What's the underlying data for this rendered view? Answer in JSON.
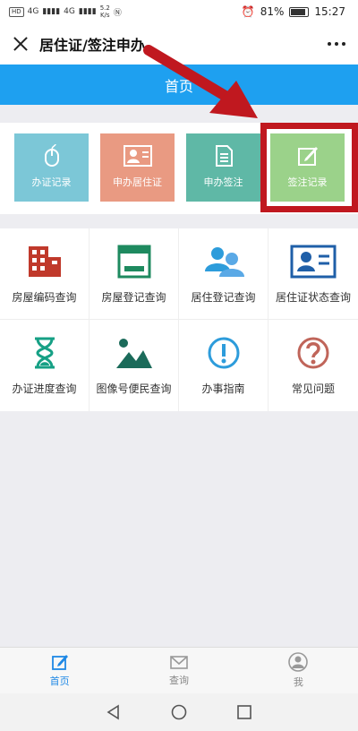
{
  "status_bar": {
    "network_left": "HD",
    "network_4g_1": "4G",
    "network_4g_2": "4G",
    "speed": "5.2",
    "speed_unit": "K/s",
    "battery_percent": "81%",
    "time": "15:27"
  },
  "header": {
    "title": "居住证/签注申办"
  },
  "blue_bar": {
    "title": "首页"
  },
  "quick_actions": [
    {
      "label": "办证记录",
      "color": "#7cc7d7",
      "icon": "mouse-icon"
    },
    {
      "label": "申办居住证",
      "color": "#e99a82",
      "icon": "id-card-icon"
    },
    {
      "label": "申办签注",
      "color": "#5fb8a6",
      "icon": "document-icon"
    },
    {
      "label": "签注记录",
      "color": "#9bd28a",
      "icon": "edit-icon"
    }
  ],
  "services": [
    {
      "label": "房屋编码查询",
      "icon": "building-icon",
      "color": "#c0392b"
    },
    {
      "label": "房屋登记查询",
      "icon": "window-icon",
      "color": "#1e8a5f"
    },
    {
      "label": "居住登记查询",
      "icon": "users-icon",
      "color": "#2d9cdb"
    },
    {
      "label": "居住证状态查询",
      "icon": "id-card-icon",
      "color": "#1f5fa8"
    },
    {
      "label": "办证进度查询",
      "icon": "hourglass-icon",
      "color": "#16a085"
    },
    {
      "label": "图像号便民查询",
      "icon": "mountain-icon",
      "color": "#1b6b5a"
    },
    {
      "label": "办事指南",
      "icon": "info-icon",
      "color": "#2d9cdb"
    },
    {
      "label": "常见问题",
      "icon": "question-icon",
      "color": "#c0655a"
    }
  ],
  "tab_bar": [
    {
      "label": "首页",
      "icon": "home-edit-icon"
    },
    {
      "label": "查询",
      "icon": "mail-icon"
    },
    {
      "label": "我",
      "icon": "user-icon"
    }
  ]
}
